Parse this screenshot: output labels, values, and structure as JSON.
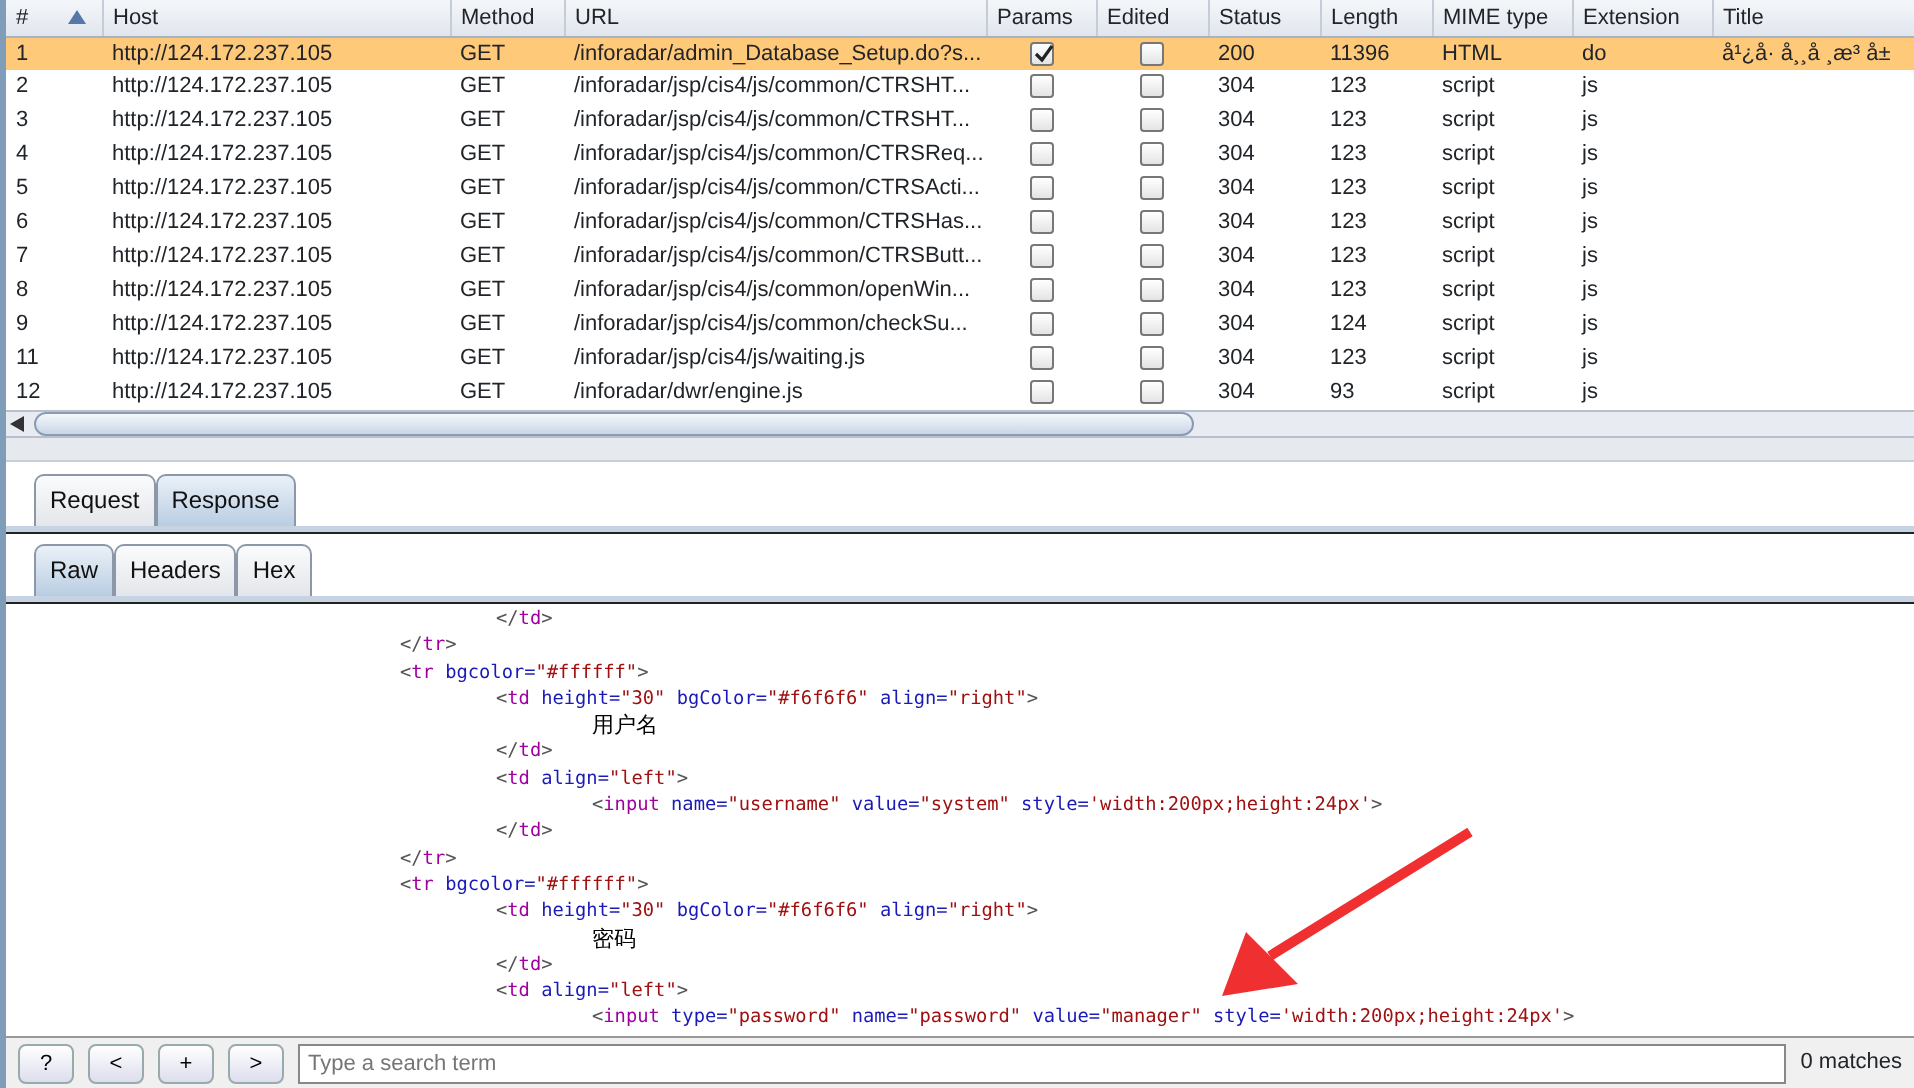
{
  "table": {
    "columns": [
      "#",
      "Host",
      "Method",
      "URL",
      "Params",
      "Edited",
      "Status",
      "Length",
      "MIME type",
      "Extension",
      "Title"
    ],
    "sort_ascending": true,
    "rows": [
      {
        "num": "1",
        "host": "http://124.172.237.105",
        "method": "GET",
        "url": "/inforadar/admin_Database_Setup.do?s...",
        "params": true,
        "edited": false,
        "status": "200",
        "length": "11396",
        "mime": "HTML",
        "extension": "do",
        "title": "å¹¿å· å¸¸å ¸æ³ å±",
        "selected": true
      },
      {
        "num": "2",
        "host": "http://124.172.237.105",
        "method": "GET",
        "url": "/inforadar/jsp/cis4/js/common/CTRSHT...",
        "params": false,
        "edited": false,
        "status": "304",
        "length": "123",
        "mime": "script",
        "extension": "js",
        "selected": false
      },
      {
        "num": "3",
        "host": "http://124.172.237.105",
        "method": "GET",
        "url": "/inforadar/jsp/cis4/js/common/CTRSHT...",
        "params": false,
        "edited": false,
        "status": "304",
        "length": "123",
        "mime": "script",
        "extension": "js",
        "selected": false
      },
      {
        "num": "4",
        "host": "http://124.172.237.105",
        "method": "GET",
        "url": "/inforadar/jsp/cis4/js/common/CTRSReq...",
        "params": false,
        "edited": false,
        "status": "304",
        "length": "123",
        "mime": "script",
        "extension": "js",
        "selected": false
      },
      {
        "num": "5",
        "host": "http://124.172.237.105",
        "method": "GET",
        "url": "/inforadar/jsp/cis4/js/common/CTRSActi...",
        "params": false,
        "edited": false,
        "status": "304",
        "length": "123",
        "mime": "script",
        "extension": "js",
        "selected": false
      },
      {
        "num": "6",
        "host": "http://124.172.237.105",
        "method": "GET",
        "url": "/inforadar/jsp/cis4/js/common/CTRSHas...",
        "params": false,
        "edited": false,
        "status": "304",
        "length": "123",
        "mime": "script",
        "extension": "js",
        "selected": false
      },
      {
        "num": "7",
        "host": "http://124.172.237.105",
        "method": "GET",
        "url": "/inforadar/jsp/cis4/js/common/CTRSButt...",
        "params": false,
        "edited": false,
        "status": "304",
        "length": "123",
        "mime": "script",
        "extension": "js",
        "selected": false
      },
      {
        "num": "8",
        "host": "http://124.172.237.105",
        "method": "GET",
        "url": "/inforadar/jsp/cis4/js/common/openWin...",
        "params": false,
        "edited": false,
        "status": "304",
        "length": "123",
        "mime": "script",
        "extension": "js",
        "selected": false
      },
      {
        "num": "9",
        "host": "http://124.172.237.105",
        "method": "GET",
        "url": "/inforadar/jsp/cis4/js/common/checkSu...",
        "params": false,
        "edited": false,
        "status": "304",
        "length": "124",
        "mime": "script",
        "extension": "js",
        "selected": false
      },
      {
        "num": "11",
        "host": "http://124.172.237.105",
        "method": "GET",
        "url": "/inforadar/jsp/cis4/js/waiting.js",
        "params": false,
        "edited": false,
        "status": "304",
        "length": "123",
        "mime": "script",
        "extension": "js",
        "selected": false
      },
      {
        "num": "12",
        "host": "http://124.172.237.105",
        "method": "GET",
        "url": "/inforadar/dwr/engine.js",
        "params": false,
        "edited": false,
        "status": "304",
        "length": "93",
        "mime": "script",
        "extension": "js",
        "selected": false
      }
    ]
  },
  "tabs": [
    {
      "label": "Request",
      "selected": false
    },
    {
      "label": "Response",
      "selected": true
    }
  ],
  "subtabs": [
    {
      "label": "Raw",
      "selected": true
    },
    {
      "label": "Headers",
      "selected": false
    },
    {
      "label": "Hex",
      "selected": false
    }
  ],
  "code_lines": [
    "\t\t\t\t\t</td>",
    "\t\t\t\t</tr>",
    "\t\t\t\t<tr bgcolor=\"#ffffff\">",
    "\t\t\t\t\t<td height=\"30\" bgColor=\"#f6f6f6\" align=\"right\">",
    "\t\t\t\t\t\t用户名",
    "\t\t\t\t\t</td>",
    "\t\t\t\t\t<td align=\"left\">",
    "\t\t\t\t\t\t<input name=\"username\" value=\"system\" style='width:200px;height:24px'>",
    "\t\t\t\t\t</td>",
    "\t\t\t\t</tr>",
    "\t\t\t\t<tr bgcolor=\"#ffffff\">",
    "\t\t\t\t\t<td height=\"30\" bgColor=\"#f6f6f6\" align=\"right\">",
    "\t\t\t\t\t\t密码",
    "\t\t\t\t\t</td>",
    "\t\t\t\t\t<td align=\"left\">",
    "\t\t\t\t\t\t<input type=\"password\" name=\"password\" value=\"manager\" style='width:200px;height:24px'>"
  ],
  "search_bar": {
    "buttons": [
      "?",
      "<",
      "+",
      ">"
    ],
    "placeholder": "Type a search term",
    "matches": "0 matches"
  }
}
